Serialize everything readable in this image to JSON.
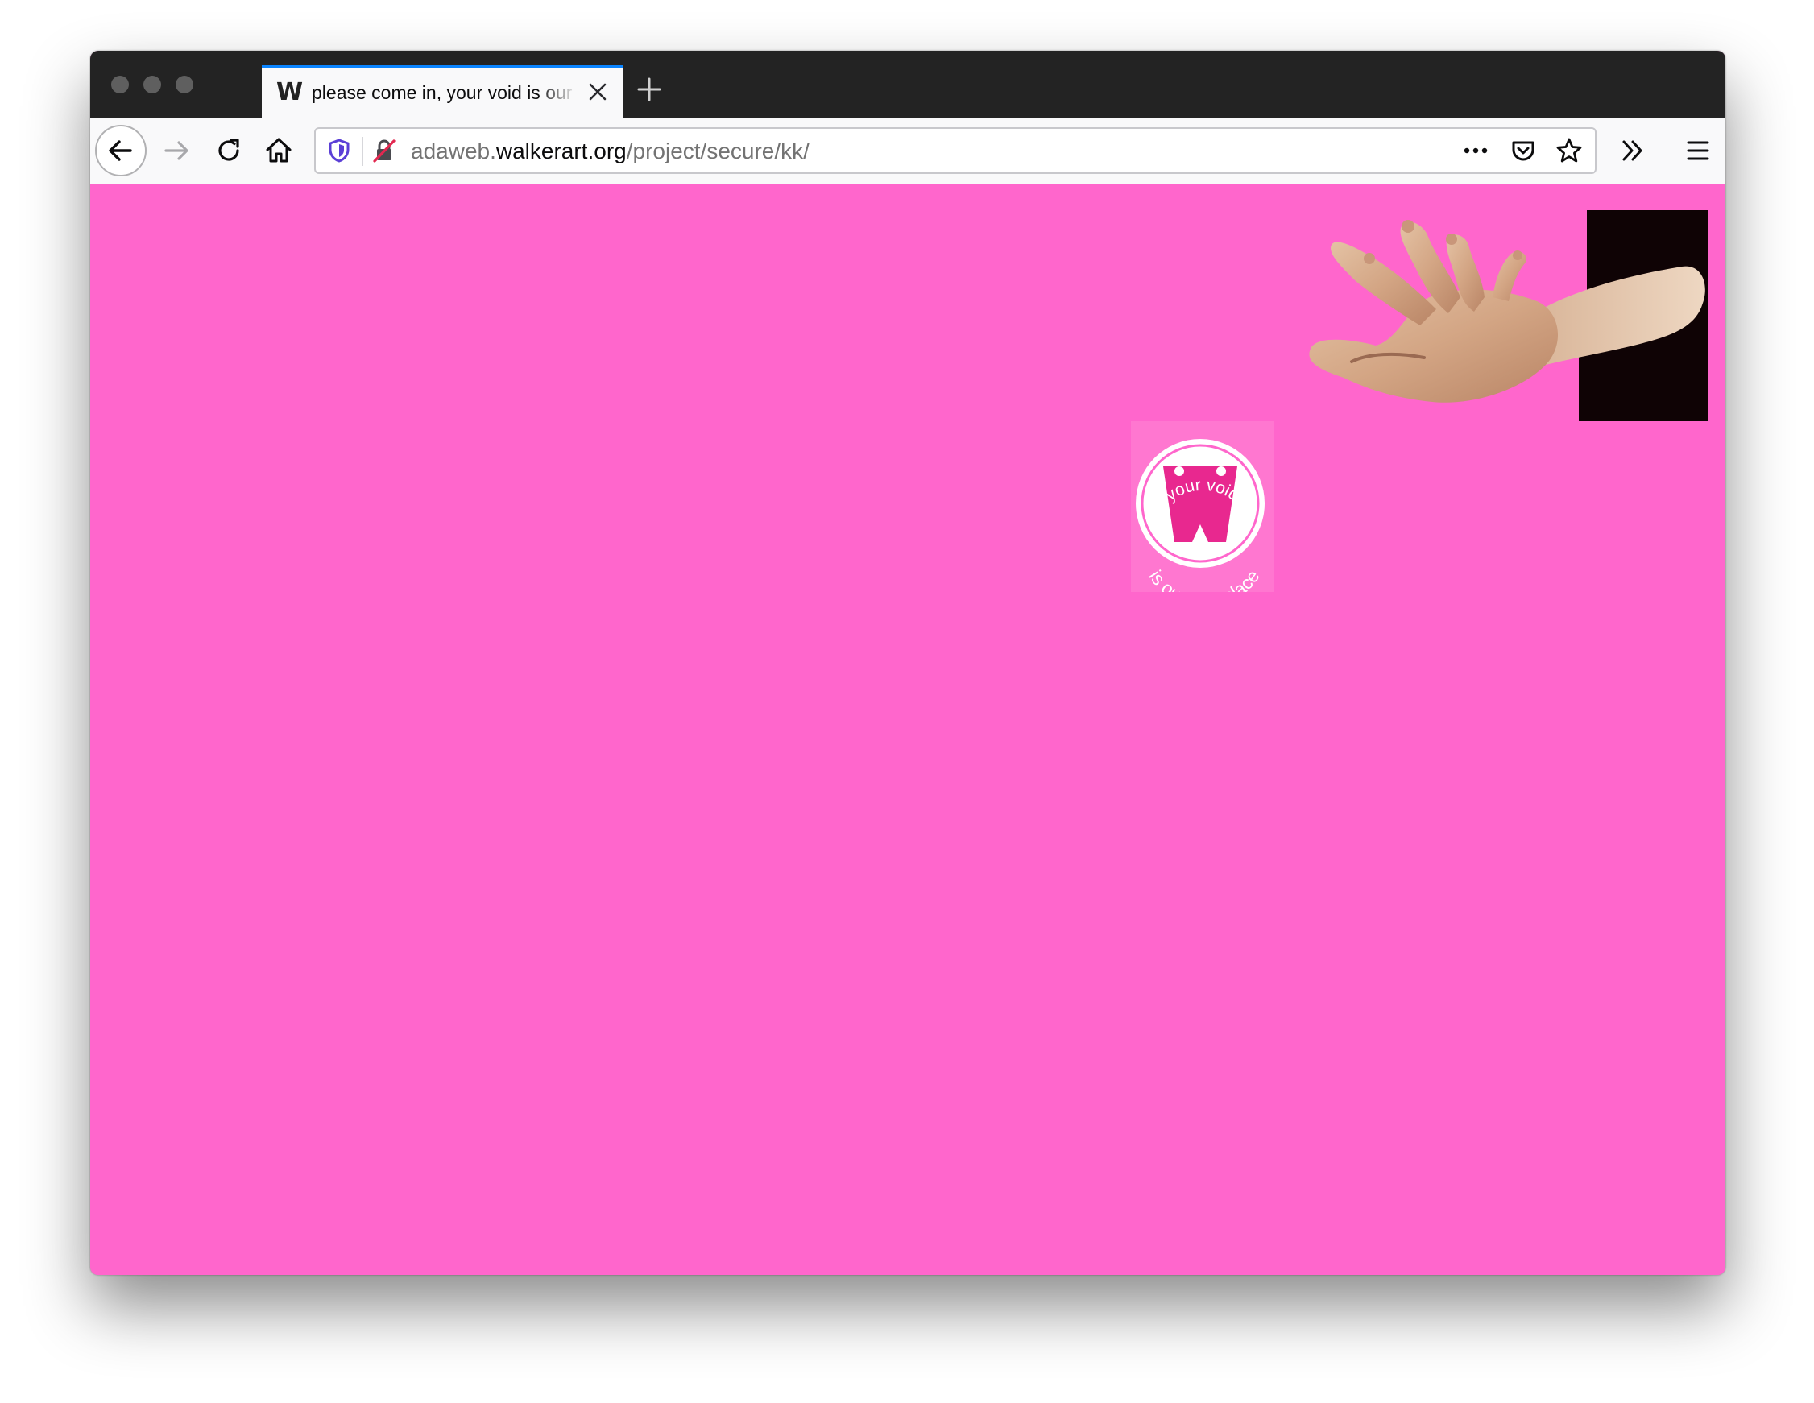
{
  "browser": {
    "tab": {
      "favicon": "W",
      "title": "please come in, your void is our workplace"
    },
    "url": {
      "prefix": "adaweb.",
      "domain": "walkerart.org",
      "path": "/project/secure/kk/"
    },
    "icons": {
      "back": "arrow-left-icon",
      "forward": "arrow-right-icon",
      "reload": "reload-icon",
      "home": "home-icon",
      "shield": "tracking-shield-icon",
      "insecure": "insecure-lock-icon",
      "more": "page-actions-icon",
      "pocket": "pocket-icon",
      "bookmark": "star-icon",
      "overflow": "chevron-double-right-icon",
      "menu": "hamburger-menu-icon"
    }
  },
  "page": {
    "background_color": "#ff66cc",
    "badge": {
      "top_text": "your void",
      "bottom_text": "is our workplace"
    }
  }
}
